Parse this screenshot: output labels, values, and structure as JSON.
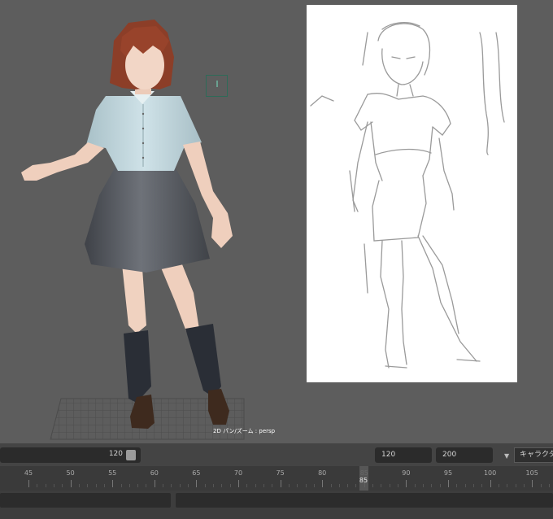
{
  "viewport": {
    "camera_label": "2D パン/ズーム : persp"
  },
  "range": {
    "slider_value": "120",
    "end_field": "120",
    "max_field": "200",
    "character_set": "キャラクタ セット"
  },
  "timeline": {
    "ticks": [
      "45",
      "50",
      "55",
      "60",
      "65",
      "70",
      "75",
      "80",
      "85",
      "90",
      "95",
      "100",
      "105"
    ],
    "current_frame": "85"
  },
  "colors": {
    "viewport_bg": "#5d5d5d",
    "sketch_bg": "#ffffff",
    "shirt": "#bcd2d8",
    "skirt": "#55585f",
    "hair": "#8c3e28",
    "socks": "#2a2e36",
    "shoes": "#3e2a1e"
  }
}
